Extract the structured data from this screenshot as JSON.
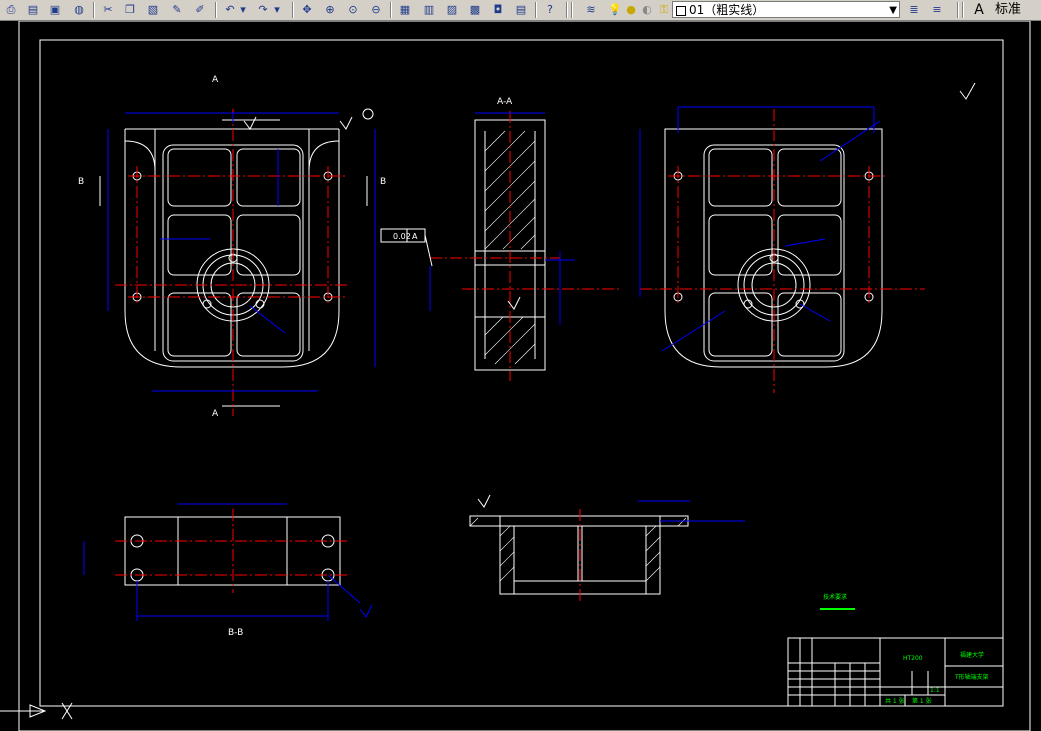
{
  "toolbar": {
    "icons": [
      "print-icon",
      "print-preview-icon",
      "publish-icon",
      "web-icon",
      "cut-icon",
      "copy-icon",
      "paste-icon",
      "match-properties-icon",
      "brush-icon",
      "undo-icon",
      "redo-icon",
      "pan-icon",
      "zoom-realtime-icon",
      "zoom-window-icon",
      "zoom-previous-icon",
      "properties-icon",
      "design-center-icon",
      "tool-palettes-icon",
      "sheet-set-icon",
      "markup-icon",
      "calculator-icon",
      "help-icon",
      "layer-manager-icon",
      "layer-on-icon",
      "layer-freeze-icon",
      "layer-lock-icon",
      "layer-prev-icon",
      "layer-states-icon",
      "text-style-icon"
    ],
    "layer": "01（粗实线）",
    "text_style": "标准"
  },
  "drawing": {
    "section_a": "A",
    "section_a_title": "A-A",
    "section_b": "B",
    "section_b_title": "B-B",
    "tolerance": "0.02",
    "datum": "A",
    "tech_req": "技术要求",
    "title_block": {
      "material": "HT200",
      "school": "福建大学",
      "part_name": "T形轴端支架",
      "scale": "1:1",
      "sheet_total": "共 1 张",
      "sheet_no": "第 1 张"
    }
  },
  "colors": {
    "background": "#000000",
    "outline": "#ffffff",
    "dimension": "#0000ff",
    "centerline": "#ff0000",
    "text": "#00ff00"
  }
}
